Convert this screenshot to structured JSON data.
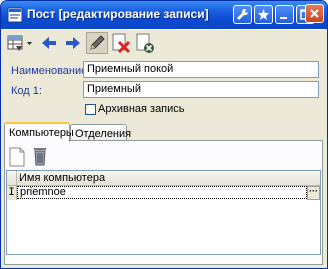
{
  "window": {
    "title": "Пост [редактирование записи]"
  },
  "titlebar_buttons": [
    "wrench-icon",
    "star-icon",
    "minimize-icon",
    "maximize-icon",
    "close-icon"
  ],
  "toolbar": {
    "items": [
      "grid-dropdown-icon",
      "back-arrow-icon",
      "forward-arrow-icon",
      "pencil-icon",
      "delete-doc-icon",
      "cancel-doc-icon"
    ]
  },
  "form": {
    "name_label": "Наименование:",
    "name_value": "Приемный покой",
    "code_label": "Код 1:",
    "code_value": "Приемный",
    "archive_label": "Архивная запись",
    "archive_checked": false
  },
  "tabs": [
    {
      "label": "Компьютеры",
      "active": true
    },
    {
      "label": "Отделения",
      "active": false
    }
  ],
  "grid": {
    "column_header": "Имя компьютера",
    "rows": [
      {
        "marker": "I",
        "value": "priemnoe",
        "button": "···"
      }
    ]
  },
  "colors": {
    "titlebar": "#0b46c4",
    "label_text": "#1e3c9a",
    "active_tab_accent": "#ffc83c"
  }
}
